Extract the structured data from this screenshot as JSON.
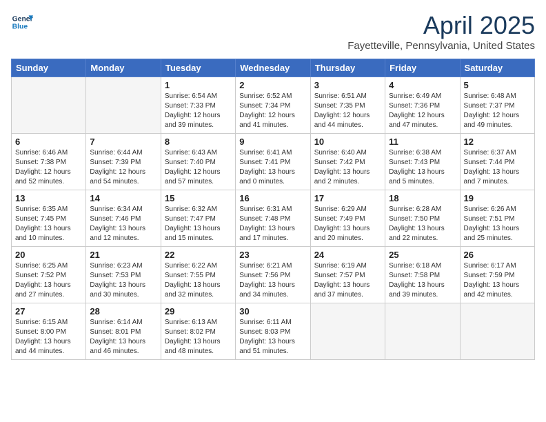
{
  "logo": {
    "line1": "General",
    "line2": "Blue"
  },
  "title": "April 2025",
  "location": "Fayetteville, Pennsylvania, United States",
  "weekdays": [
    "Sunday",
    "Monday",
    "Tuesday",
    "Wednesday",
    "Thursday",
    "Friday",
    "Saturday"
  ],
  "weeks": [
    [
      {
        "day": "",
        "info": ""
      },
      {
        "day": "",
        "info": ""
      },
      {
        "day": "1",
        "info": "Sunrise: 6:54 AM\nSunset: 7:33 PM\nDaylight: 12 hours and 39 minutes."
      },
      {
        "day": "2",
        "info": "Sunrise: 6:52 AM\nSunset: 7:34 PM\nDaylight: 12 hours and 41 minutes."
      },
      {
        "day": "3",
        "info": "Sunrise: 6:51 AM\nSunset: 7:35 PM\nDaylight: 12 hours and 44 minutes."
      },
      {
        "day": "4",
        "info": "Sunrise: 6:49 AM\nSunset: 7:36 PM\nDaylight: 12 hours and 47 minutes."
      },
      {
        "day": "5",
        "info": "Sunrise: 6:48 AM\nSunset: 7:37 PM\nDaylight: 12 hours and 49 minutes."
      }
    ],
    [
      {
        "day": "6",
        "info": "Sunrise: 6:46 AM\nSunset: 7:38 PM\nDaylight: 12 hours and 52 minutes."
      },
      {
        "day": "7",
        "info": "Sunrise: 6:44 AM\nSunset: 7:39 PM\nDaylight: 12 hours and 54 minutes."
      },
      {
        "day": "8",
        "info": "Sunrise: 6:43 AM\nSunset: 7:40 PM\nDaylight: 12 hours and 57 minutes."
      },
      {
        "day": "9",
        "info": "Sunrise: 6:41 AM\nSunset: 7:41 PM\nDaylight: 13 hours and 0 minutes."
      },
      {
        "day": "10",
        "info": "Sunrise: 6:40 AM\nSunset: 7:42 PM\nDaylight: 13 hours and 2 minutes."
      },
      {
        "day": "11",
        "info": "Sunrise: 6:38 AM\nSunset: 7:43 PM\nDaylight: 13 hours and 5 minutes."
      },
      {
        "day": "12",
        "info": "Sunrise: 6:37 AM\nSunset: 7:44 PM\nDaylight: 13 hours and 7 minutes."
      }
    ],
    [
      {
        "day": "13",
        "info": "Sunrise: 6:35 AM\nSunset: 7:45 PM\nDaylight: 13 hours and 10 minutes."
      },
      {
        "day": "14",
        "info": "Sunrise: 6:34 AM\nSunset: 7:46 PM\nDaylight: 13 hours and 12 minutes."
      },
      {
        "day": "15",
        "info": "Sunrise: 6:32 AM\nSunset: 7:47 PM\nDaylight: 13 hours and 15 minutes."
      },
      {
        "day": "16",
        "info": "Sunrise: 6:31 AM\nSunset: 7:48 PM\nDaylight: 13 hours and 17 minutes."
      },
      {
        "day": "17",
        "info": "Sunrise: 6:29 AM\nSunset: 7:49 PM\nDaylight: 13 hours and 20 minutes."
      },
      {
        "day": "18",
        "info": "Sunrise: 6:28 AM\nSunset: 7:50 PM\nDaylight: 13 hours and 22 minutes."
      },
      {
        "day": "19",
        "info": "Sunrise: 6:26 AM\nSunset: 7:51 PM\nDaylight: 13 hours and 25 minutes."
      }
    ],
    [
      {
        "day": "20",
        "info": "Sunrise: 6:25 AM\nSunset: 7:52 PM\nDaylight: 13 hours and 27 minutes."
      },
      {
        "day": "21",
        "info": "Sunrise: 6:23 AM\nSunset: 7:53 PM\nDaylight: 13 hours and 30 minutes."
      },
      {
        "day": "22",
        "info": "Sunrise: 6:22 AM\nSunset: 7:55 PM\nDaylight: 13 hours and 32 minutes."
      },
      {
        "day": "23",
        "info": "Sunrise: 6:21 AM\nSunset: 7:56 PM\nDaylight: 13 hours and 34 minutes."
      },
      {
        "day": "24",
        "info": "Sunrise: 6:19 AM\nSunset: 7:57 PM\nDaylight: 13 hours and 37 minutes."
      },
      {
        "day": "25",
        "info": "Sunrise: 6:18 AM\nSunset: 7:58 PM\nDaylight: 13 hours and 39 minutes."
      },
      {
        "day": "26",
        "info": "Sunrise: 6:17 AM\nSunset: 7:59 PM\nDaylight: 13 hours and 42 minutes."
      }
    ],
    [
      {
        "day": "27",
        "info": "Sunrise: 6:15 AM\nSunset: 8:00 PM\nDaylight: 13 hours and 44 minutes."
      },
      {
        "day": "28",
        "info": "Sunrise: 6:14 AM\nSunset: 8:01 PM\nDaylight: 13 hours and 46 minutes."
      },
      {
        "day": "29",
        "info": "Sunrise: 6:13 AM\nSunset: 8:02 PM\nDaylight: 13 hours and 48 minutes."
      },
      {
        "day": "30",
        "info": "Sunrise: 6:11 AM\nSunset: 8:03 PM\nDaylight: 13 hours and 51 minutes."
      },
      {
        "day": "",
        "info": ""
      },
      {
        "day": "",
        "info": ""
      },
      {
        "day": "",
        "info": ""
      }
    ]
  ]
}
